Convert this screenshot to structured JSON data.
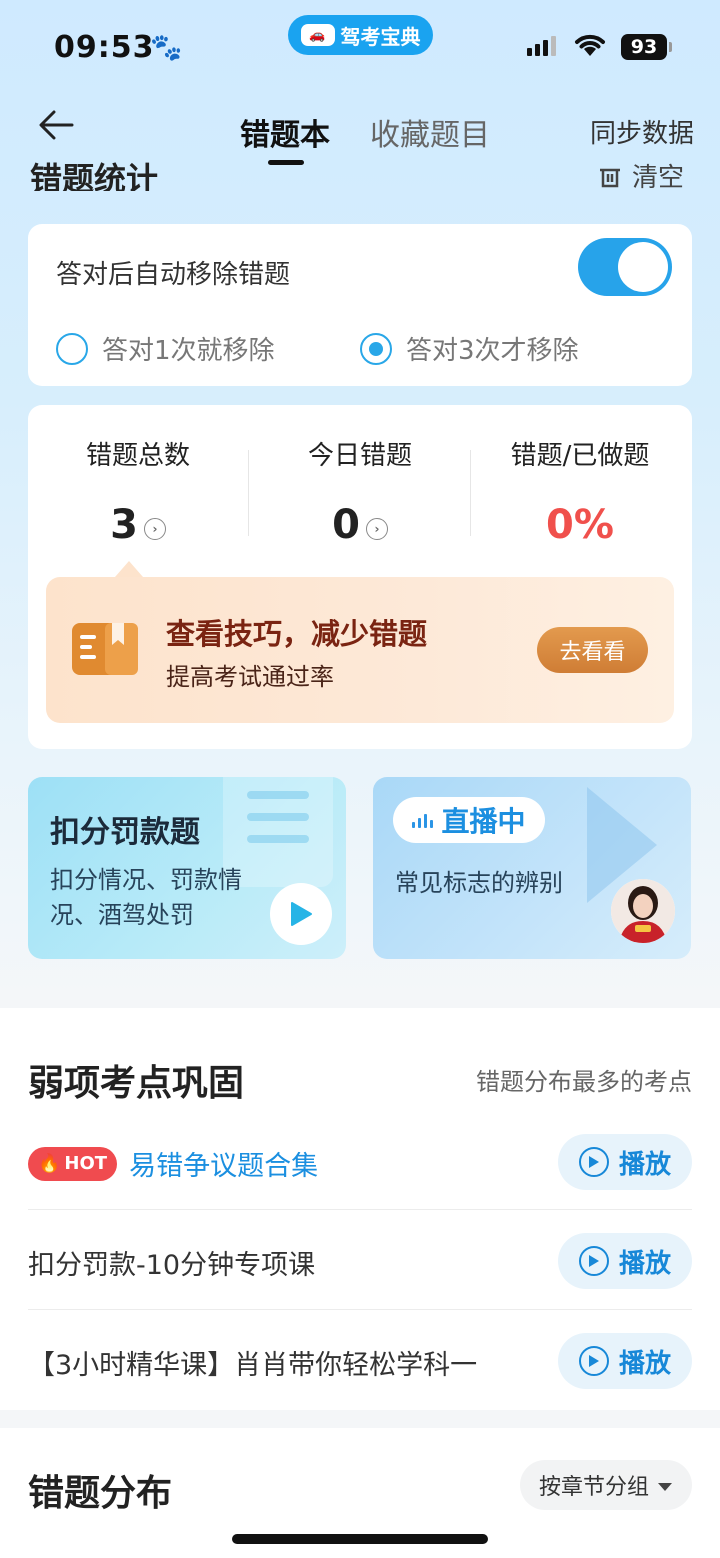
{
  "status_bar": {
    "time": "09:53",
    "app_badge": "驾考宝典",
    "battery": "93"
  },
  "nav": {
    "tab_active": "错题本",
    "tab_inactive": "收藏题目",
    "sync": "同步数据"
  },
  "stats_header": {
    "title": "错题统计",
    "clear": "清空"
  },
  "auto_remove": {
    "label": "答对后自动移除错题",
    "enabled": true,
    "options": [
      {
        "label": "答对1次就移除",
        "selected": false
      },
      {
        "label": "答对3次才移除",
        "selected": true
      }
    ]
  },
  "stats": [
    {
      "label": "错题总数",
      "value": "3"
    },
    {
      "label": "今日错题",
      "value": "0"
    },
    {
      "label": "错题/已做题",
      "value": "0%"
    }
  ],
  "tip": {
    "title": "查看技巧，减少错题",
    "subtitle": "提高考试通过率",
    "button": "去看看"
  },
  "promo_left": {
    "title": "扣分罚款题",
    "desc": "扣分情况、罚款情况、酒驾处罚"
  },
  "promo_right": {
    "live": "直播中",
    "desc": "常见标志的辨别"
  },
  "weak": {
    "title": "弱项考点巩固",
    "hint": "错题分布最多的考点",
    "hot_badge": "HOT",
    "play_label": "播放",
    "items": [
      {
        "title": "易错争议题合集"
      },
      {
        "title": "扣分罚款-10分钟专项课"
      },
      {
        "title": "【3小时精华课】肖肖带你轻松学科一"
      }
    ]
  },
  "distribution": {
    "title": "错题分布",
    "group_button": "按章节分组"
  },
  "colors": {
    "accent": "#27a3ea",
    "red": "#f0504c",
    "tip_title": "#7a2412"
  }
}
